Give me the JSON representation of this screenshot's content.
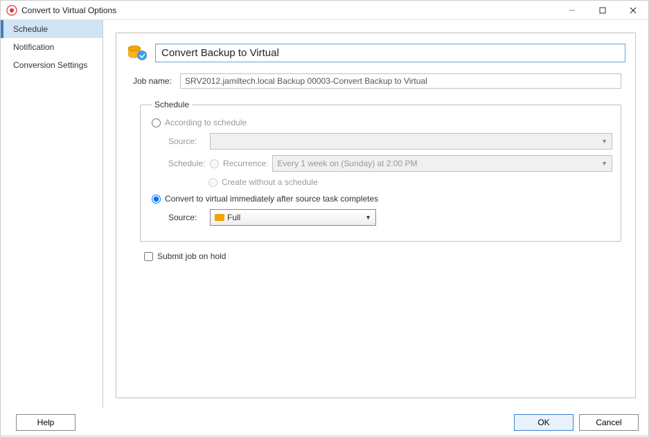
{
  "window": {
    "title": "Convert to Virtual Options"
  },
  "sidebar": {
    "items": [
      {
        "label": "Schedule",
        "active": true
      },
      {
        "label": "Notification",
        "active": false
      },
      {
        "label": "Conversion Settings",
        "active": false
      }
    ]
  },
  "panel": {
    "header_title": "Convert Backup to Virtual",
    "jobname_label": "Job name:",
    "jobname_value": "SRV2012.jamiltech.local Backup 00003-Convert Backup to Virtual",
    "schedule_legend": "Schedule",
    "according_label": "According to schedule",
    "source_label": "Source:",
    "source_value": "",
    "schedule_label": "Schedule:",
    "recurrence_label": "Recurrence:",
    "recurrence_value": "Every 1 week on (Sunday) at 2:00 PM",
    "create_without_label": "Create without a schedule",
    "convert_immediate_label": "Convert to virtual immediately after source task completes",
    "convert_source_label": "Source:",
    "convert_source_value": "Full",
    "submit_on_hold_label": "Submit job on hold"
  },
  "footer": {
    "help": "Help",
    "ok": "OK",
    "cancel": "Cancel"
  }
}
